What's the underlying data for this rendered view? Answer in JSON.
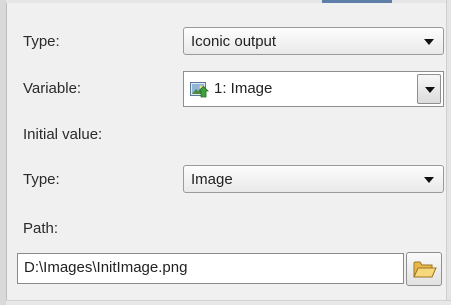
{
  "fields": {
    "type_label": "Type:",
    "type_value": "Iconic output",
    "variable_label": "Variable:",
    "variable_value": "1: Image",
    "initial_value_label": "Initial value:",
    "initial_type_label": "Type:",
    "initial_type_value": "Image",
    "path_label": "Path:",
    "path_value": "D:\\Images\\InitImage.png"
  },
  "icons": {
    "variable_icon": "image-variable-icon",
    "browse_icon": "open-folder-icon"
  }
}
